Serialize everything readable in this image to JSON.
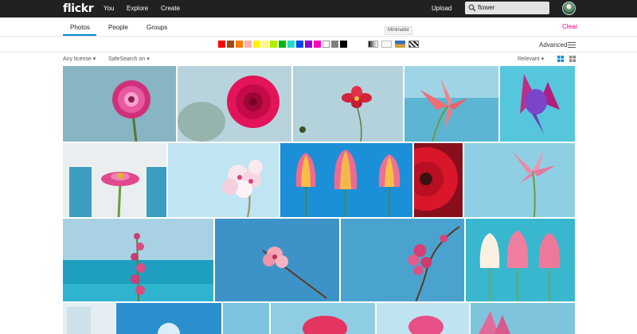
{
  "nav": {
    "logo": "flickr",
    "you": "You",
    "explore": "Explore",
    "create": "Create",
    "upload": "Upload",
    "search_value": "flower"
  },
  "tabs": [
    {
      "label": "Photos",
      "active": true
    },
    {
      "label": "People",
      "active": false
    },
    {
      "label": "Groups",
      "active": false
    }
  ],
  "clear_label": "Clear",
  "colors": [
    "#ff0000",
    "#a24615",
    "#ff7b00",
    "#ffb0ad",
    "#fef600",
    "#fff48e",
    "#b2ed00",
    "#00ba11",
    "#24dbcb",
    "#0049e7",
    "#9700d8",
    "#ff00c0",
    "#ffffff",
    "#808080",
    "#000000"
  ],
  "styles_tooltip": "Minimalist",
  "advanced_label": "Advanced",
  "license_label": "Any license",
  "safesearch_label": "SafeSearch on",
  "sort_label": "Relevant"
}
